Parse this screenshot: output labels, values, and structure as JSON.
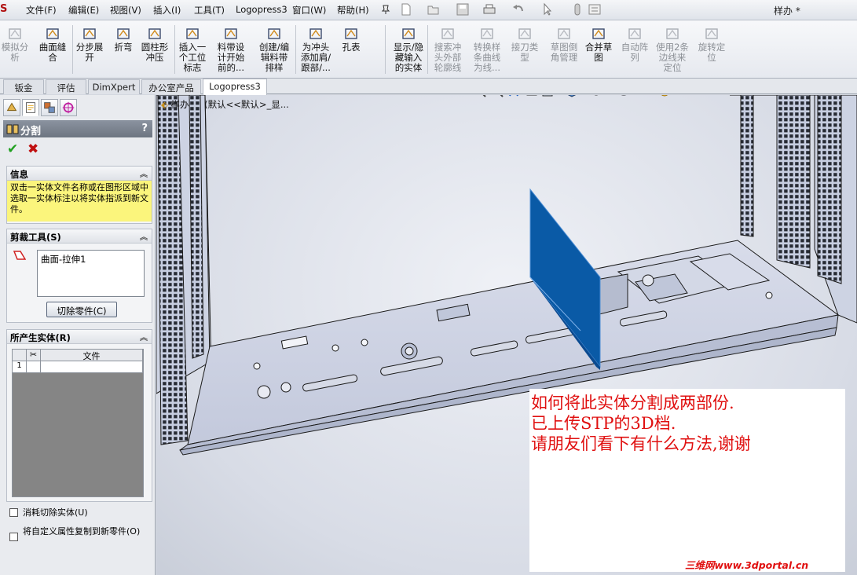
{
  "menubar": {
    "app_logo": "S",
    "items": [
      "文件(F)",
      "编辑(E)",
      "视图(V)",
      "插入(I)",
      "工具(T)",
      "Logopress3",
      "窗口(W)",
      "帮助(H)"
    ],
    "doc_title": "样办 *"
  },
  "ribbon": {
    "buttons": [
      {
        "label": "模拟分\n析",
        "disabled": true,
        "icon": "simulate-icon"
      },
      {
        "label": "曲面缝\n合",
        "disabled": false,
        "icon": "knit-surface-icon"
      },
      {
        "label": "分步展\n开",
        "disabled": false,
        "icon": "step-unfold-icon"
      },
      {
        "label": "折弯",
        "disabled": false,
        "icon": "bend-icon"
      },
      {
        "label": "圆柱形\n冲压",
        "disabled": false,
        "icon": "cylinder-stamp-icon"
      },
      {
        "label": "插入一\n个工位\n标志",
        "disabled": false,
        "icon": "station-marker-icon"
      },
      {
        "label": "料带设\n计开始\n前的...",
        "disabled": false,
        "icon": "strip-design-icon"
      },
      {
        "label": "创建/编\n辑料带\n排样",
        "disabled": false,
        "icon": "strip-layout-icon"
      },
      {
        "label": "为冲头\n添加肩/\n跟部/...",
        "disabled": false,
        "icon": "punch-shoulder-icon"
      },
      {
        "label": "孔表",
        "disabled": false,
        "icon": "hole-table-icon"
      },
      {
        "label": "显示/隐\n藏输入\n的实体",
        "disabled": false,
        "icon": "show-hide-icon"
      },
      {
        "label": "搜索冲\n头外部\n轮廓线",
        "disabled": true,
        "icon": "search-punch-icon"
      },
      {
        "label": "转换样\n条曲线\n为线...",
        "disabled": true,
        "icon": "convert-spline-icon"
      },
      {
        "label": "接刀类\n型",
        "disabled": true,
        "icon": "cut-type-icon"
      },
      {
        "label": "草图倒\n角管理",
        "disabled": true,
        "icon": "sketch-chamfer-icon"
      },
      {
        "label": "合并草\n图",
        "disabled": false,
        "icon": "merge-sketch-icon"
      },
      {
        "label": "自动阵\n列",
        "disabled": true,
        "icon": "auto-pattern-icon"
      },
      {
        "label": "使用2条\n边线来\n定位",
        "disabled": true,
        "icon": "two-edge-locate-icon"
      },
      {
        "label": "旋转定\n位",
        "disabled": true,
        "icon": "rotate-locate-icon"
      }
    ]
  },
  "tabs": [
    "钣金",
    "评估",
    "DimXpert",
    "办公室产品",
    "Logopress3"
  ],
  "active_tab": "Logopress3",
  "panel": {
    "title": "分割",
    "help": "?",
    "ok": "✔",
    "cancel": "✖",
    "info": {
      "heading": "信息",
      "text": "双击一实体文件名称或在图形区域中选取一实体标注以将实体指派到新文件。"
    },
    "trim_tools": {
      "heading": "剪裁工具(S)",
      "selection": "曲面-拉伸1",
      "cut_button": "切除零件(C)"
    },
    "resulting_bodies": {
      "heading": "所产生实体(R)",
      "col_file": "文件",
      "row_num": "1"
    },
    "options": {
      "consume": "消耗切除实体(U)",
      "copy_props": "将自定义属性复制到新零件(O)"
    }
  },
  "graphics": {
    "tree_label": "样办",
    "tree_config": "(默认<<默认>_显..."
  },
  "annotation": {
    "lines": [
      "如何将此实体分割成两部份.",
      "已上传STP的3D档.",
      "请朋友们看下有什么方法,谢谢"
    ],
    "color": "#e01010"
  },
  "watermark": "三维网www.3dportal.cn",
  "colors": {
    "split_plane": "#0a5aa6",
    "model_fill": "#c6cde0",
    "model_edge": "#1a1a1a"
  }
}
